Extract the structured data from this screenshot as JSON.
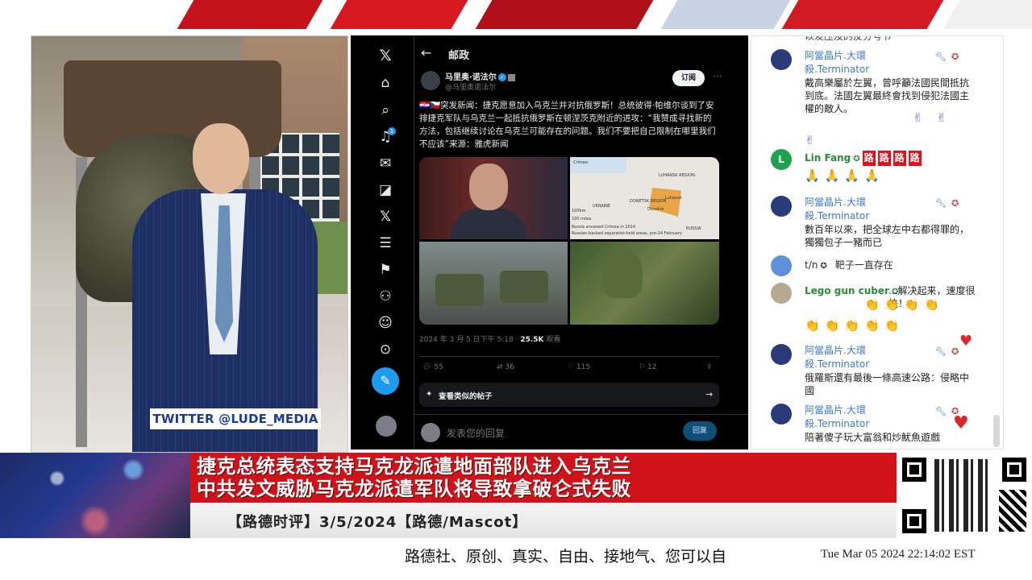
{
  "colors": {
    "brand_red": "#d0121a",
    "x_background": "#000000",
    "x_accent": "#1d9bf0",
    "chat_author_blue": "#3d78c9",
    "chat_author_green": "#2a8a3a"
  },
  "presenter": {
    "twitter_handle_tag": "TWITTER @LUDE_MEDIA"
  },
  "x_post": {
    "nav_icons": [
      "x-logo-icon",
      "home-icon",
      "search-icon",
      "bell-icon",
      "mail-icon",
      "grok-icon",
      "x-icon",
      "lists-icon",
      "bookmark-icon",
      "communities-icon",
      "profile-icon",
      "more-icon"
    ],
    "notification_count": "1",
    "header_title": "邮政",
    "author_name": "马里奥·诺法尔",
    "author_handle": "@马里奥诺法尔",
    "subscribe_label": "订阅",
    "text": "🇭🇷🇨🇿突发新闻：捷克愿意加入乌克兰并对抗俄罗斯！总统彼得·帕维尔谈到了安排捷克军队与乌克兰一起抵抗俄罗斯在顿涅茨克附近的进攻：“我赞成寻找新的方法，包括继续讨论在乌克兰可能存在的问题。我们不要把自己限制在哪里我们不应该”来源：雅虎新闻",
    "map_labels": [
      "Crimea",
      "LUHANSK REGION",
      "Luhansk",
      "Donetsk",
      "DONETSK REGION",
      "UKRAINE",
      "RUSSIA",
      "100km",
      "100 miles",
      "Russia annexed Crimea in 2014",
      "Russian-backed separatist-held areas, pre-24 February"
    ],
    "timestamp": "2024 年 3 月 5 日下午 5:18 · ",
    "views_count": "25.5K",
    "views_label": " 观看",
    "replies": "55",
    "reposts": "36",
    "likes": "115",
    "bookmarks": "12",
    "similar_posts_label": "查看类似的帖子",
    "reply_placeholder": "发表您的回复",
    "reply_button": "回复"
  },
  "chat": {
    "top_fragment": "以发压及的反分号节",
    "messages": [
      {
        "author": "阿當晶片.大環",
        "author2": "殺.Terminator",
        "text": "戴高樂屬於左翼，曾呼籲法國民間抵抗到底。法國左翼最終會找到侵犯法國主權的敵人。",
        "emoji": "✌ ✌",
        "emoji2": "✌"
      },
      {
        "author": "Lin Fang",
        "avatar_letter": "L",
        "tags": [
          "路",
          "路",
          "路",
          "路"
        ],
        "emoji": "🙏🙏🙏🙏"
      },
      {
        "author": "阿當晶片.大環",
        "author2": "殺.Terminator",
        "text": "數百年以來，把全球左中右都得罪的，獨獨包子一豬而已"
      },
      {
        "author": "t/n",
        "text": "靶子一直存在"
      },
      {
        "author": "Lego gun cuber",
        "text": "...解决起来，速度很快！",
        "emoji": "👏👏👏👏",
        "emoji2": "👏👏👏👏👏"
      },
      {
        "author": "阿當晶片.大環",
        "author2": "殺.Terminator",
        "text": "俄羅斯還有最後一條高速公路：侵略中國"
      },
      {
        "author": "阿當晶片.大環",
        "author2": "殺.Terminator",
        "text": "陪著傻子玩大富翁和炒魷魚遊戲"
      }
    ]
  },
  "bottom": {
    "headline_line1": "捷克总统表态支持马克龙派遣地面部队进入乌克兰",
    "headline_line2": "中共发文威胁马克龙派遣军队将导致拿破仑式失败",
    "subhead": "【路德时评】3/5/2024【路德/Mascot】",
    "ticker": "路德社、原创、真实、自由、接地气、您可以自",
    "clock": "Tue Mar 05 2024 22:14:02 EST"
  }
}
